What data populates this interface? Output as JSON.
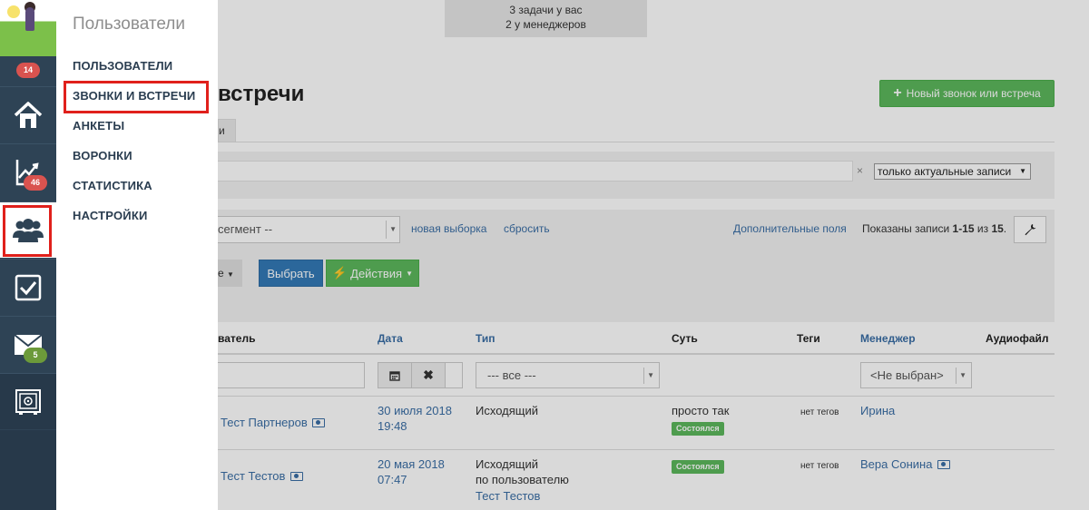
{
  "notice": {
    "line1": "3 задачи у вас",
    "line2": "2 у менеджеров"
  },
  "page": {
    "title_partial": "встречи",
    "new_button": "Новый звонок или встреча",
    "tab_partial": "и"
  },
  "filter": {
    "clear": "×",
    "scope": "только актуальные записи"
  },
  "segment": {
    "select_value_partial": "сегмент --",
    "new_selection": "новая выборка",
    "reset": "сбросить",
    "extra_fields": "Дополнительные поля",
    "shown_prefix": "Показаны записи ",
    "shown_range": "1-15",
    "shown_mid": " из ",
    "shown_total": "15",
    "shown_suffix": ".",
    "partial_button": "е",
    "select_button": "Выбрать",
    "actions_button": "Действия"
  },
  "table": {
    "headers": {
      "user_partial": "ватель",
      "date": "Дата",
      "type": "Тип",
      "essence": "Суть",
      "tags": "Теги",
      "manager": "Менеджер",
      "audio": "Аудиофайл"
    },
    "filters": {
      "type": "--- все ---",
      "manager": "<Не выбран>"
    },
    "rows": [
      {
        "user": "Тест Партнеров",
        "date": "30 июля 2018",
        "time": "19:48",
        "type": "Исходящий",
        "essence": "просто так",
        "status": "Состоялся",
        "tags": "нет тегов",
        "manager": "Ирина"
      },
      {
        "user": "Тест Тестов",
        "date": "20 мая 2018",
        "time": "07:47",
        "type": "Исходящий",
        "type_line2": "по пользователю",
        "type_line3": "Тест Тестов",
        "status": "Состоялся",
        "tags": "нет тегов",
        "manager": "Вера Сонина"
      }
    ]
  },
  "nav": {
    "badges": {
      "avatar": "14",
      "stats": "46",
      "mail": "5"
    },
    "icons": [
      "home-icon",
      "chart-icon",
      "users-icon",
      "checkbox-icon",
      "mail-icon",
      "safe-icon"
    ]
  },
  "flyout": {
    "title": "Пользователи",
    "items": [
      "ПОЛЬЗОВАТЕЛИ",
      "ЗВОНКИ И ВСТРЕЧИ",
      "АНКЕТЫ",
      "ВОРОНКИ",
      "СТАТИСТИКА",
      "НАСТРОЙКИ"
    ]
  },
  "colors": {
    "nav_bg": "#2e4355",
    "highlight": "#e0201b",
    "green": "#5cb85c",
    "blue": "#337ab7",
    "link": "#3a6ea5"
  }
}
